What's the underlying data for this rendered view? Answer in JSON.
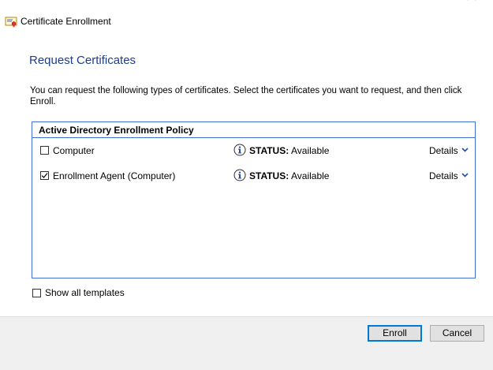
{
  "window": {
    "title": "Certificate Enrollment"
  },
  "page": {
    "heading": "Request Certificates",
    "description": "You can request the following types of certificates. Select the certificates you want to request, and then click Enroll."
  },
  "policy": {
    "title": "Active Directory Enrollment Policy",
    "certificates": [
      {
        "name": "Computer",
        "checked": false,
        "status_label": "STATUS:",
        "status_value": "Available",
        "details_label": "Details"
      },
      {
        "name": "Enrollment Agent (Computer)",
        "checked": true,
        "status_label": "STATUS:",
        "status_value": "Available",
        "details_label": "Details"
      }
    ]
  },
  "options": {
    "show_all_templates_label": "Show all templates",
    "show_all_templates_checked": false
  },
  "buttons": {
    "enroll_label": "Enroll",
    "cancel_label": "Cancel"
  },
  "colors": {
    "heading": "#1f3c8c",
    "policy_border": "#3f6fd0",
    "footer_bg": "#f0f0f0",
    "default_button_border": "#0078d7"
  },
  "icons": {
    "title": "certificate-icon",
    "status": "info-icon",
    "details": "chevron-down-icon"
  }
}
